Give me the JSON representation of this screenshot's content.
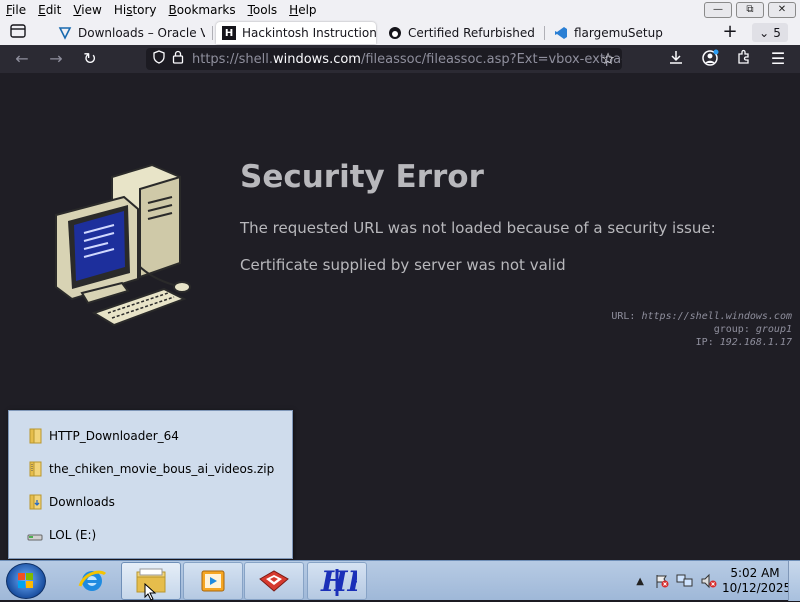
{
  "menu": [
    {
      "label": "File",
      "key": "F"
    },
    {
      "label": "Edit",
      "key": "E"
    },
    {
      "label": "View",
      "key": "V"
    },
    {
      "label": "History",
      "key": "s"
    },
    {
      "label": "Bookmarks",
      "key": "B"
    },
    {
      "label": "Tools",
      "key": "T"
    },
    {
      "label": "Help",
      "key": "H"
    }
  ],
  "menu_labels": {
    "file": "File",
    "edit": "Edit",
    "view": "View",
    "history": "History",
    "bookmarks": "Bookmarks",
    "tools": "Tools",
    "help": "Help"
  },
  "tabs": {
    "t1": "Downloads – Oracle Vir",
    "t2": "Hackintosh Instructions",
    "t3": "Certified Refurbished Pr",
    "t4": "flargemuSetup",
    "count": "5"
  },
  "url": {
    "prefix": "https://shell.",
    "host": "windows.com",
    "rest": "/fileassoc/fileassoc.asp?Ext=vbox-extpac"
  },
  "error": {
    "title": "Security Error",
    "description": "The requested URL was not loaded because of a security issue:",
    "detail": "Certificate supplied by server was not valid",
    "url_label": "URL: ",
    "url_value": "https://shell.windows.com",
    "group_label": "group: ",
    "group_value": "group1",
    "ip_label": "IP: ",
    "ip_value": "192.168.1.17"
  },
  "jumplist": {
    "i1": "HTTP_Downloader_64",
    "i2": "the_chiken_movie_bous_ai_videos.zip",
    "i3": "Downloads",
    "i4": "LOL (E:)"
  },
  "clock": {
    "time": "5:02 AM",
    "date": "10/12/2025"
  },
  "colors": {
    "page_bg": "#1f1e25",
    "toolbar_bg": "#2b2a33",
    "taskbar": "#a9c0dc",
    "error_text": "#b8b8bc"
  }
}
